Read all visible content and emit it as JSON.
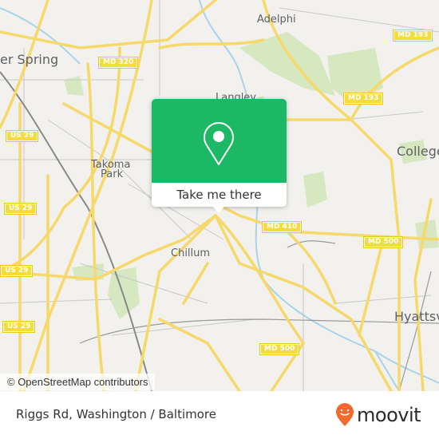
{
  "map": {
    "places": [
      {
        "id": "silver-spring",
        "label": "er Spring"
      },
      {
        "id": "adelphi",
        "label": "Adelphi"
      },
      {
        "id": "langley",
        "label": "Langley"
      },
      {
        "id": "takoma-park-1",
        "label": "Takoma"
      },
      {
        "id": "takoma-park-2",
        "label": "Park"
      },
      {
        "id": "college-park",
        "label": "College"
      },
      {
        "id": "chillum",
        "label": "Chillum"
      },
      {
        "id": "hyattsville",
        "label": "Hyattsvil"
      }
    ],
    "shields": [
      {
        "id": "md-320",
        "label": "MD 320"
      },
      {
        "id": "md-193-top",
        "label": "MD 193"
      },
      {
        "id": "md-193-mid",
        "label": "MD 193"
      },
      {
        "id": "us-29-a",
        "label": "US 29"
      },
      {
        "id": "us-29-b",
        "label": "US 29"
      },
      {
        "id": "us-29-c",
        "label": "US 29"
      },
      {
        "id": "us-29-d",
        "label": "US 29"
      },
      {
        "id": "md-410",
        "label": "MD 410"
      },
      {
        "id": "md-500-right",
        "label": "MD 500"
      },
      {
        "id": "md-500-bottom",
        "label": "MD 500"
      }
    ],
    "attribution": "© OpenStreetMap contributors"
  },
  "popup": {
    "icon": "map-pin-icon",
    "button_label": "Take me there"
  },
  "footer": {
    "address": "Riggs Rd, Washington / Baltimore",
    "brand": "moovit",
    "brand_color": "#f26a2e",
    "accent_green": "#1db866"
  }
}
